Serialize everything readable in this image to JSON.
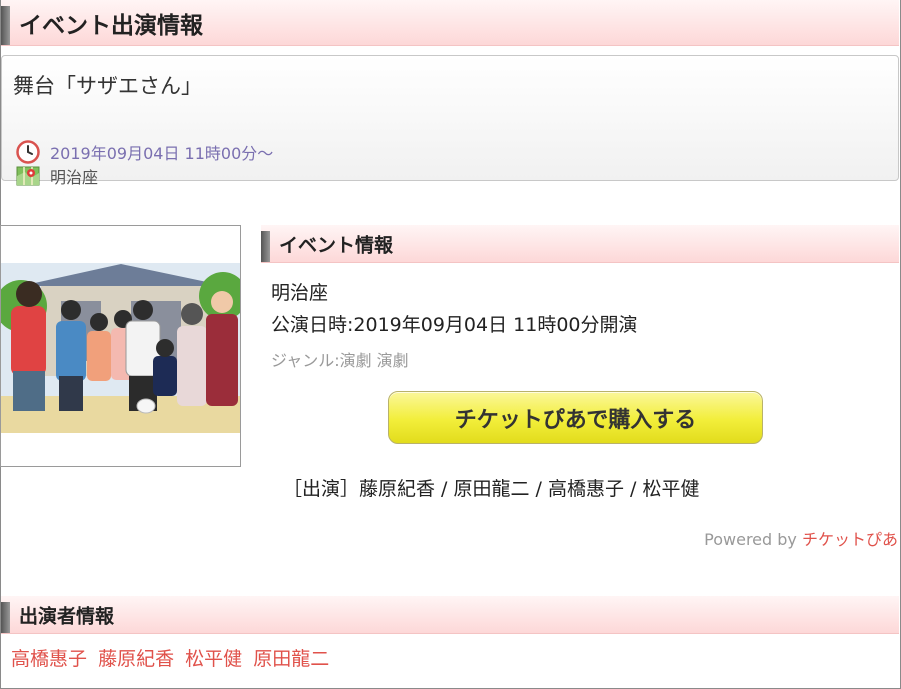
{
  "section_main": {
    "title": "イベント出演情報"
  },
  "event": {
    "title": "舞台「サザエさん」",
    "venue": "明治座",
    "datetime": "2019年09月04日 11時00分〜",
    "venue_icon": "map-icon",
    "clock_icon": "clock-icon"
  },
  "event_info": {
    "header": "イベント情報",
    "venue": "明治座",
    "date": "公演日時:2019年09月04日 11時00分開演",
    "genre": "ジャンル:演劇 演劇",
    "buy_button": "チケットぴあで購入する",
    "cast_line": "［出演］藤原紀香 / 原田龍二 / 高橋惠子 / 松平健",
    "powered_prefix": "Powered by ",
    "powered_link": "チケットぴあ"
  },
  "performers": {
    "header": "出演者情報",
    "names": [
      "高橋惠子",
      "藤原紀香",
      "松平健",
      "原田龍二"
    ]
  },
  "colors": {
    "link": "#e0524b",
    "datetime": "#7a6fb0",
    "header_bg": "#fdd8d8",
    "button": "#f2ee3a"
  }
}
